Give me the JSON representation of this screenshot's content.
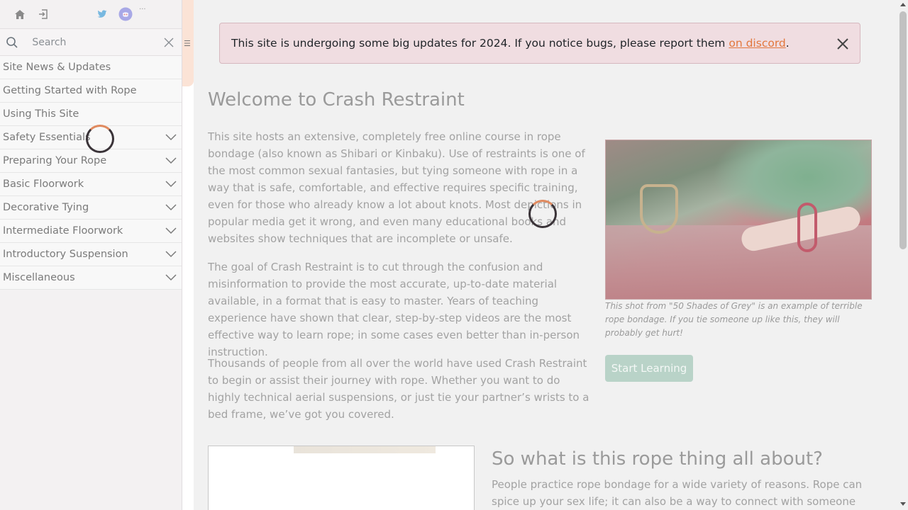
{
  "sidebar": {
    "search_placeholder": "Search",
    "items": [
      {
        "label": "Site News & Updates",
        "expandable": false
      },
      {
        "label": "Getting Started with Rope",
        "expandable": false
      },
      {
        "label": "Using This Site",
        "expandable": false
      },
      {
        "label": "Safety Essentials",
        "expandable": true
      },
      {
        "label": "Preparing Your Rope",
        "expandable": true
      },
      {
        "label": "Basic Floorwork",
        "expandable": true
      },
      {
        "label": "Decorative Tying",
        "expandable": true
      },
      {
        "label": "Intermediate Floorwork",
        "expandable": true
      },
      {
        "label": "Introductory Suspension",
        "expandable": true
      },
      {
        "label": "Miscellaneous",
        "expandable": true
      }
    ],
    "top_icons": [
      "home-icon",
      "login-icon",
      "twitter-icon",
      "discord-icon"
    ]
  },
  "alert": {
    "text": "This site is undergoing some big updates for 2024. If you notice bugs, please report them",
    "link": "on discord",
    "suffix": "."
  },
  "main": {
    "title": "Welcome to Crash Restraint",
    "p1": "This site hosts an extensive, completely free online course in rope bondage (also known as Shibari or Kinbaku). Use of restraints is one of the most common sexual fantasies, but tying someone with rope in a way that is safe, comfortable, and effective requires specific training, even for those who already know a lot about knots. Most depictions in popular media get it wrong, and even many educational books and websites show techniques that are incomplete or unsafe.",
    "p2": "The goal of Crash Restraint is to cut through the confusion and misinformation to provide the most accurate, up-to-date material available, in a format that is easy to master. Years of teaching experience have shown that clear, step-by-step videos are the most effective way to learn rope; in some cases even better than in-person instruction.",
    "p3": "Thousands of people from all over the world have used Crash Restraint to begin or assist their journey with rope. Whether you want to do highly technical aerial suspensions, or just tie your partner’s wrists to a bed frame, we’ve got you covered.",
    "caption": "This shot from \"50 Shades of Grey\" is an example of terrible rope bondage. If you tie someone up like this, they will probably get hurt!",
    "start_button": "Start Learning",
    "section2_title": "So what is this rope thing all about?",
    "section2_text": "People practice rope bondage for a wide variety of reasons. Rope can spice up your sex life; it can also be a way to connect with someone non-sexually."
  },
  "colors": {
    "accent": "#e2773d",
    "alert_bg": "#f0dde1",
    "button_bg": "#b9d3c8",
    "sidebar_bg": "#f3f1f2"
  }
}
